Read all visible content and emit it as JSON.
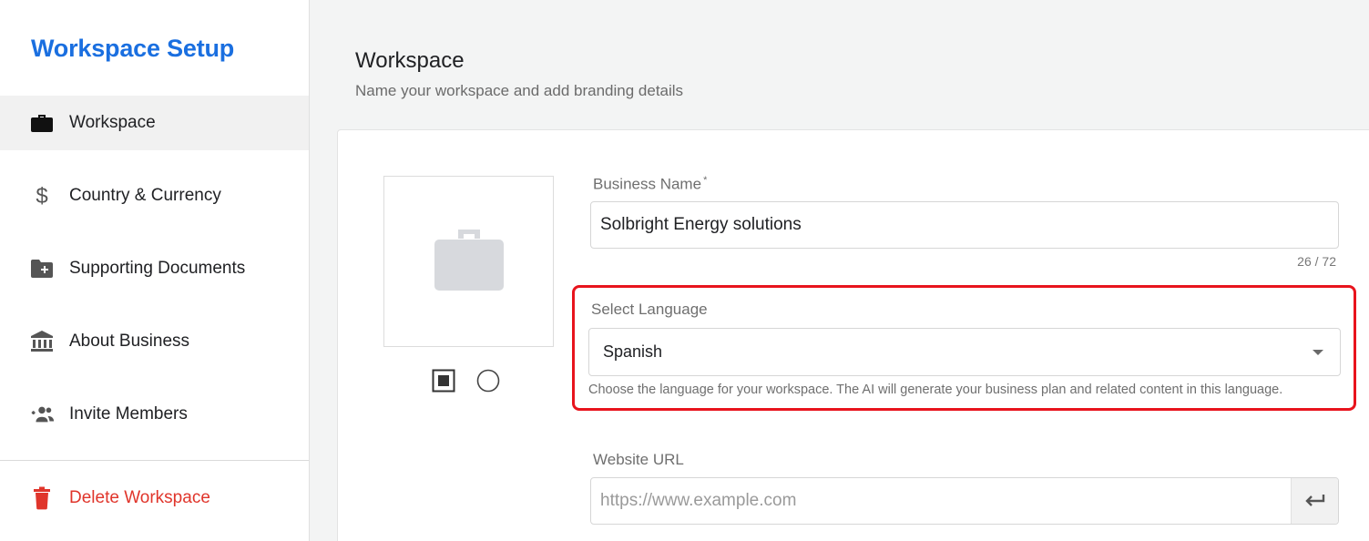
{
  "sidebar": {
    "title": "Workspace Setup",
    "items": [
      {
        "label": "Workspace",
        "icon": "briefcase-icon",
        "active": true
      },
      {
        "label": "Country & Currency",
        "icon": "dollar-icon"
      },
      {
        "label": "Supporting Documents",
        "icon": "folder-plus-icon"
      },
      {
        "label": "About Business",
        "icon": "bank-icon"
      },
      {
        "label": "Invite Members",
        "icon": "group-add-icon"
      }
    ],
    "delete": {
      "label": "Delete Workspace",
      "icon": "trash-icon"
    }
  },
  "header": {
    "title": "Workspace",
    "subtitle": "Name your workspace and add branding details"
  },
  "form": {
    "business_name": {
      "label": "Business Name",
      "required_mark": "*",
      "value": "Solbright Energy solutions",
      "counter": "26 / 72"
    },
    "language": {
      "label": "Select Language",
      "value": "Spanish",
      "helper": "Choose the language for your workspace. The AI will generate your business plan and related content in this language."
    },
    "website": {
      "label": "Website URL",
      "placeholder": "https://www.example.com",
      "value": ""
    }
  },
  "colors": {
    "accent": "#1a6fe0",
    "danger": "#e0352b",
    "highlight": "#e8141d"
  }
}
